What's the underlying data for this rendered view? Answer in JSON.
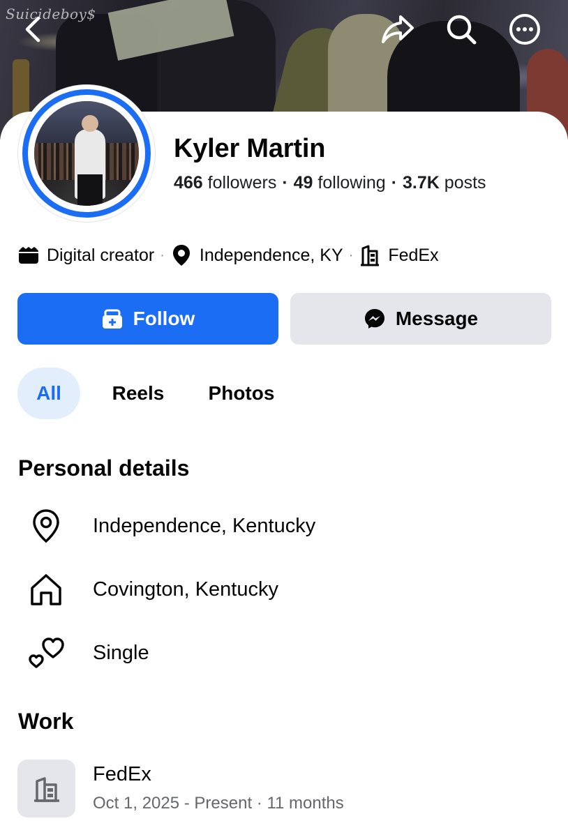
{
  "cover": {
    "overlay_text": "Suicideboy$"
  },
  "nav": {
    "back_icon": "chevron-left-icon",
    "share_icon": "share-arrow-icon",
    "search_icon": "search-icon",
    "more_icon": "more-horizontal-icon"
  },
  "profile": {
    "name": "Kyler Martin",
    "followers_count": "466",
    "followers_label": "followers",
    "following_count": "49",
    "following_label": "following",
    "posts_count": "3.7K",
    "posts_label": "posts",
    "separator": "·"
  },
  "intro": {
    "category": "Digital creator",
    "location": "Independence, KY",
    "workplace": "FedEx",
    "separator": "·"
  },
  "actions": {
    "follow_label": "Follow",
    "message_label": "Message"
  },
  "tabs": [
    {
      "label": "All",
      "active": true
    },
    {
      "label": "Reels",
      "active": false
    },
    {
      "label": "Photos",
      "active": false
    }
  ],
  "personal_details": {
    "title": "Personal details",
    "items": [
      {
        "icon": "location-pin-icon",
        "text": "Independence, Kentucky"
      },
      {
        "icon": "home-icon",
        "text": "Covington, Kentucky"
      },
      {
        "icon": "hearts-icon",
        "text": "Single"
      }
    ]
  },
  "work": {
    "title": "Work",
    "items": [
      {
        "icon": "building-icon",
        "company": "FedEx",
        "period": "Oct 1, 2025 - Present · 11 months"
      }
    ]
  },
  "colors": {
    "accent": "#1b6df3",
    "accent_light": "#e3eefd",
    "secondary_button": "#e4e6eb",
    "muted_text": "#65676b"
  }
}
